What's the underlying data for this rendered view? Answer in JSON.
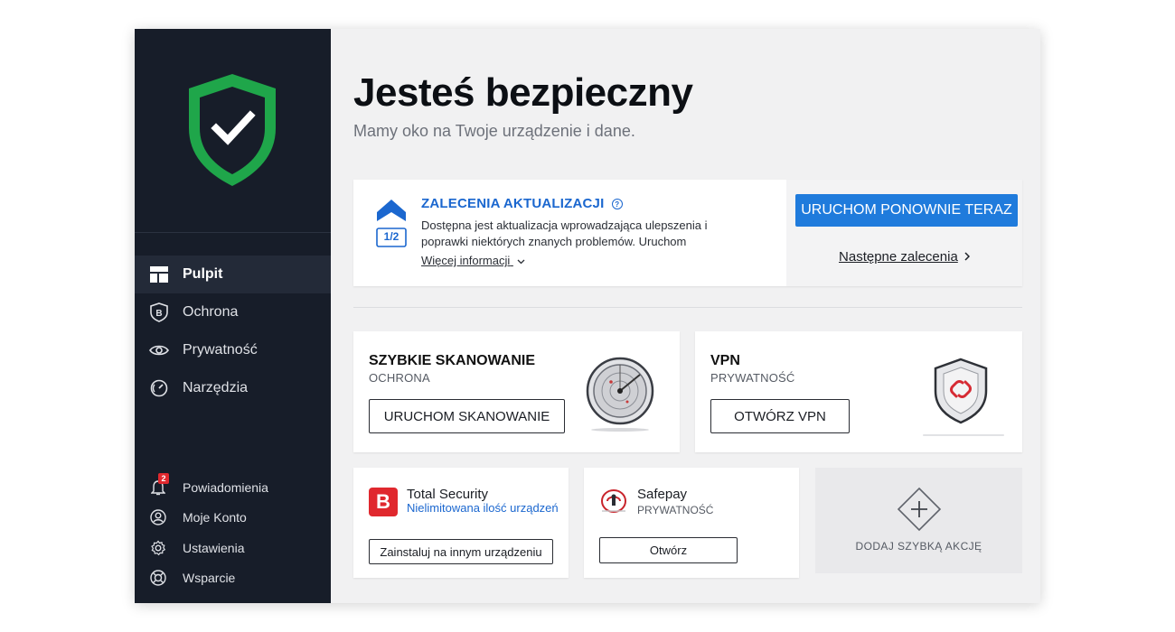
{
  "sidebar": {
    "nav": [
      {
        "label": "Pulpit",
        "icon": "dashboard-icon"
      },
      {
        "label": "Ochrona",
        "icon": "protection-b-icon"
      },
      {
        "label": "Prywatność",
        "icon": "eye-icon"
      },
      {
        "label": "Narzędzia",
        "icon": "gauge-icon"
      }
    ],
    "bottom": [
      {
        "label": "Powiadomienia",
        "icon": "bell-icon",
        "badge": "2"
      },
      {
        "label": "Moje Konto",
        "icon": "account-icon"
      },
      {
        "label": "Ustawienia",
        "icon": "gear-icon"
      },
      {
        "label": "Wsparcie",
        "icon": "lifebuoy-icon"
      }
    ]
  },
  "header": {
    "title": "Jesteś bezpieczny",
    "subtitle": "Mamy oko na Twoje urządzenie i dane."
  },
  "recommendation": {
    "title": "ZALECENIA AKTUALIZACJI",
    "counter": "1/2",
    "text": "Dostępna jest aktualizacja wprowadzająca ulepszenia i poprawki niektórych znanych problemów. Uruchom",
    "more": "Więcej informacji",
    "button": "URUCHOM PONOWNIE TERAZ",
    "next": "Następne zalecenia"
  },
  "quick_scan": {
    "title": "SZYBKIE SKANOWANIE",
    "subtitle": "OCHRONA",
    "button": "URUCHOM SKANOWANIE"
  },
  "vpn": {
    "title": "VPN",
    "subtitle": "PRYWATNOŚĆ",
    "button": "OTWÓRZ VPN"
  },
  "total_security": {
    "title": "Total Security",
    "link": "Nielimitowana ilość urządzeń",
    "button": "Zainstaluj na innym urządzeniu"
  },
  "safepay": {
    "title": "Safepay",
    "subtitle": "PRYWATNOŚĆ",
    "button": "Otwórz"
  },
  "add_action": {
    "label": "DODAJ SZYBKĄ AKCJĘ"
  },
  "colors": {
    "sidebar": "#171d29",
    "accent_blue": "#1f7bdc",
    "shield_green": "#1fa64a",
    "brand_red": "#e0282e"
  }
}
